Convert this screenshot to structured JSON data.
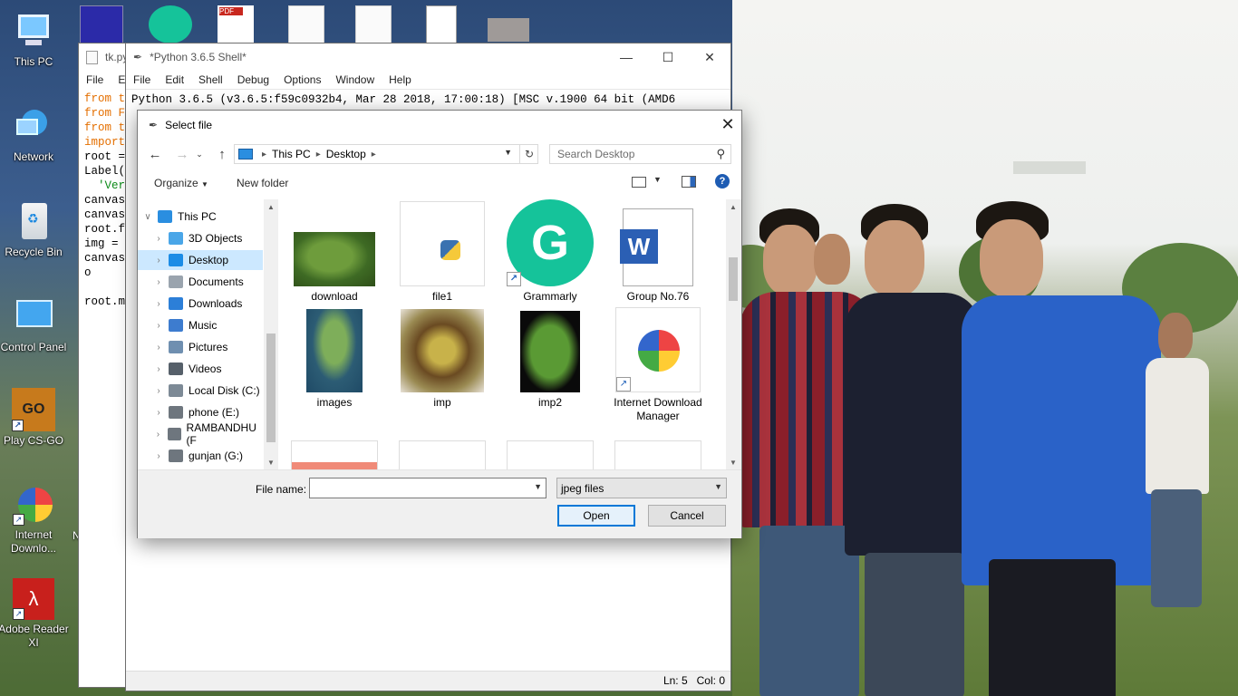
{
  "desktop": {
    "icons": [
      {
        "label": "This PC",
        "icon": "computer-icon"
      },
      {
        "label": "Network",
        "icon": "network-icon"
      },
      {
        "label": "Recycle Bin",
        "icon": "recycle-bin-icon"
      },
      {
        "label": "Control Panel",
        "icon": "control-panel-icon"
      },
      {
        "label": "Play CS-GO",
        "icon": "csgo-icon"
      },
      {
        "label": "Internet Downlo...",
        "icon": "idm-icon"
      },
      {
        "label": "Adobe Reader XI",
        "icon": "adobe-reader-icon"
      }
    ],
    "partial_label": "N"
  },
  "editor_window": {
    "title": "tk.py",
    "menu": [
      "File",
      "Ed"
    ],
    "code_lines": [
      {
        "t": "from t",
        "c": "kw"
      },
      {
        "t": "from F",
        "c": "kw"
      },
      {
        "t": "from t",
        "c": "kw"
      },
      {
        "t": "import ",
        "c": "kw"
      },
      {
        "t": "root =",
        "c": ""
      },
      {
        "t": "Label(",
        "c": ""
      },
      {
        "t": "  'Ver",
        "c": "gr"
      },
      {
        "t": "canvas",
        "c": ""
      },
      {
        "t": "canvas",
        "c": ""
      },
      {
        "t": "root.f",
        "c": ""
      },
      {
        "t": "img = ",
        "c": ""
      },
      {
        "t": "canvas",
        "c": ""
      },
      {
        "t": "o",
        "c": ""
      },
      {
        "t": "",
        "c": ""
      },
      {
        "t": "root.m",
        "c": ""
      }
    ]
  },
  "shell_window": {
    "title": "*Python 3.6.5 Shell*",
    "menu": [
      "File",
      "Edit",
      "Shell",
      "Debug",
      "Options",
      "Window",
      "Help"
    ],
    "banner": "Python 3.6.5 (v3.6.5:f59c0932b4, Mar 28 2018, 17:00:18) [MSC v.1900 64 bit (AMD6",
    "status": "Ln: 5   Col: 0"
  },
  "dialog": {
    "title": "Select file",
    "address": [
      "This PC",
      "Desktop"
    ],
    "search_placeholder": "Search Desktop",
    "organize": "Organize",
    "new_folder": "New folder",
    "nav_items": [
      {
        "label": "This PC",
        "icon": "computer-icon",
        "color": "#2a8ee0",
        "top": true
      },
      {
        "label": "3D Objects",
        "icon": "cube-icon",
        "color": "#4aa6e8"
      },
      {
        "label": "Desktop",
        "icon": "desktop-icon",
        "color": "#1c8ce6",
        "selected": true
      },
      {
        "label": "Documents",
        "icon": "documents-icon",
        "color": "#9aa4ae"
      },
      {
        "label": "Downloads",
        "icon": "download-arrow-icon",
        "color": "#2c7fd8"
      },
      {
        "label": "Music",
        "icon": "music-note-icon",
        "color": "#3d7ccf"
      },
      {
        "label": "Pictures",
        "icon": "pictures-icon",
        "color": "#6f8fb0"
      },
      {
        "label": "Videos",
        "icon": "videos-icon",
        "color": "#56606a"
      },
      {
        "label": "Local Disk (C:)",
        "icon": "drive-icon",
        "color": "#7d8a96"
      },
      {
        "label": "phone (E:)",
        "icon": "drive-icon",
        "color": "#6e767e"
      },
      {
        "label": "RAMBANDHU (F",
        "icon": "drive-icon",
        "color": "#6e767e"
      },
      {
        "label": "gunjan (G:)",
        "icon": "drive-icon",
        "color": "#6e767e"
      }
    ],
    "files": [
      {
        "name": "download",
        "kind": "leaf-photo"
      },
      {
        "name": "file1",
        "kind": "python"
      },
      {
        "name": "Grammarly",
        "kind": "grammarly",
        "shortcut": true
      },
      {
        "name": "Group No.76",
        "kind": "word"
      },
      {
        "name": "images",
        "kind": "leaf-blue"
      },
      {
        "name": "imp",
        "kind": "leaf-sick"
      },
      {
        "name": "imp2",
        "kind": "leaf-dark"
      },
      {
        "name": "Internet Download Manager",
        "kind": "idm",
        "shortcut": true
      }
    ],
    "file_name_label": "File name:",
    "file_name_value": "",
    "file_type": "jpeg files",
    "open_label": "Open",
    "cancel_label": "Cancel"
  }
}
